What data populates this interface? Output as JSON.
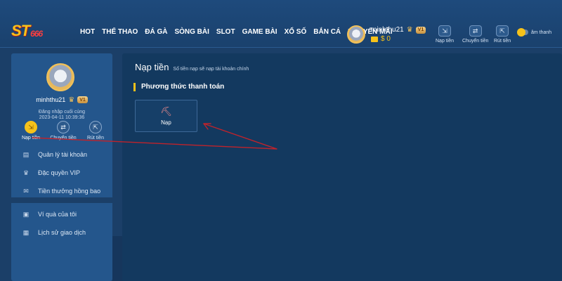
{
  "brand": {
    "logo_main": "ST",
    "logo_num": "666"
  },
  "nav": [
    "HOT",
    "THỂ THAO",
    "ĐÁ GÀ",
    "SÒNG BÀI",
    "SLOT",
    "GAME BÀI",
    "XỔ SỐ",
    "BẮN CÁ",
    "KHUYẾN MÃI"
  ],
  "user": {
    "name": "minhthu21",
    "vip": "V1",
    "balance": "$ 0"
  },
  "quick_actions": [
    {
      "label": "Nạp tiền",
      "icon": "deposit-icon",
      "glyph": "⇲"
    },
    {
      "label": "Chuyển tiền",
      "icon": "transfer-icon",
      "glyph": "⇄"
    },
    {
      "label": "Rút tiền",
      "icon": "withdraw-icon",
      "glyph": "⇱"
    }
  ],
  "sound_toggle": {
    "label": "âm thanh"
  },
  "sidebar": {
    "last_login_label": "Đăng nhập cuối cùng",
    "last_login_time": "2023-04-11 10:39:36",
    "actions": [
      {
        "label": "Nạp tiền",
        "active": true
      },
      {
        "label": "Chuyển tiền",
        "active": false
      },
      {
        "label": "Rút tiền",
        "active": false
      }
    ],
    "menu_group_1": [
      {
        "label": "Quản lý tài khoản",
        "icon": "id-card-icon",
        "glyph": "▤"
      },
      {
        "label": "Đặc quyền VIP",
        "icon": "crown-icon",
        "glyph": "♛"
      },
      {
        "label": "Tiền thưởng hồng bao",
        "icon": "envelope-icon",
        "glyph": "✉"
      }
    ],
    "menu_group_2": [
      {
        "label": "Ví quà của tôi",
        "icon": "gift-wallet-icon",
        "glyph": "▣"
      },
      {
        "label": "Lịch sử giao dịch",
        "icon": "history-icon",
        "glyph": "▦"
      }
    ]
  },
  "main": {
    "title": "Nạp tiền",
    "subtitle": "Số tiền nạp sẽ nạp tài khoản chính",
    "section_title": "Phương thức thanh toán",
    "methods": [
      {
        "label": "Nạp",
        "icon": "hand-coin-icon",
        "glyph": "⛏"
      }
    ]
  },
  "colors": {
    "accent": "#f6c21a",
    "header_bg": "#1e4a7c",
    "sidebar_bg": "#24568c",
    "main_bg": "#13395f",
    "annotation": "#c0232b"
  }
}
